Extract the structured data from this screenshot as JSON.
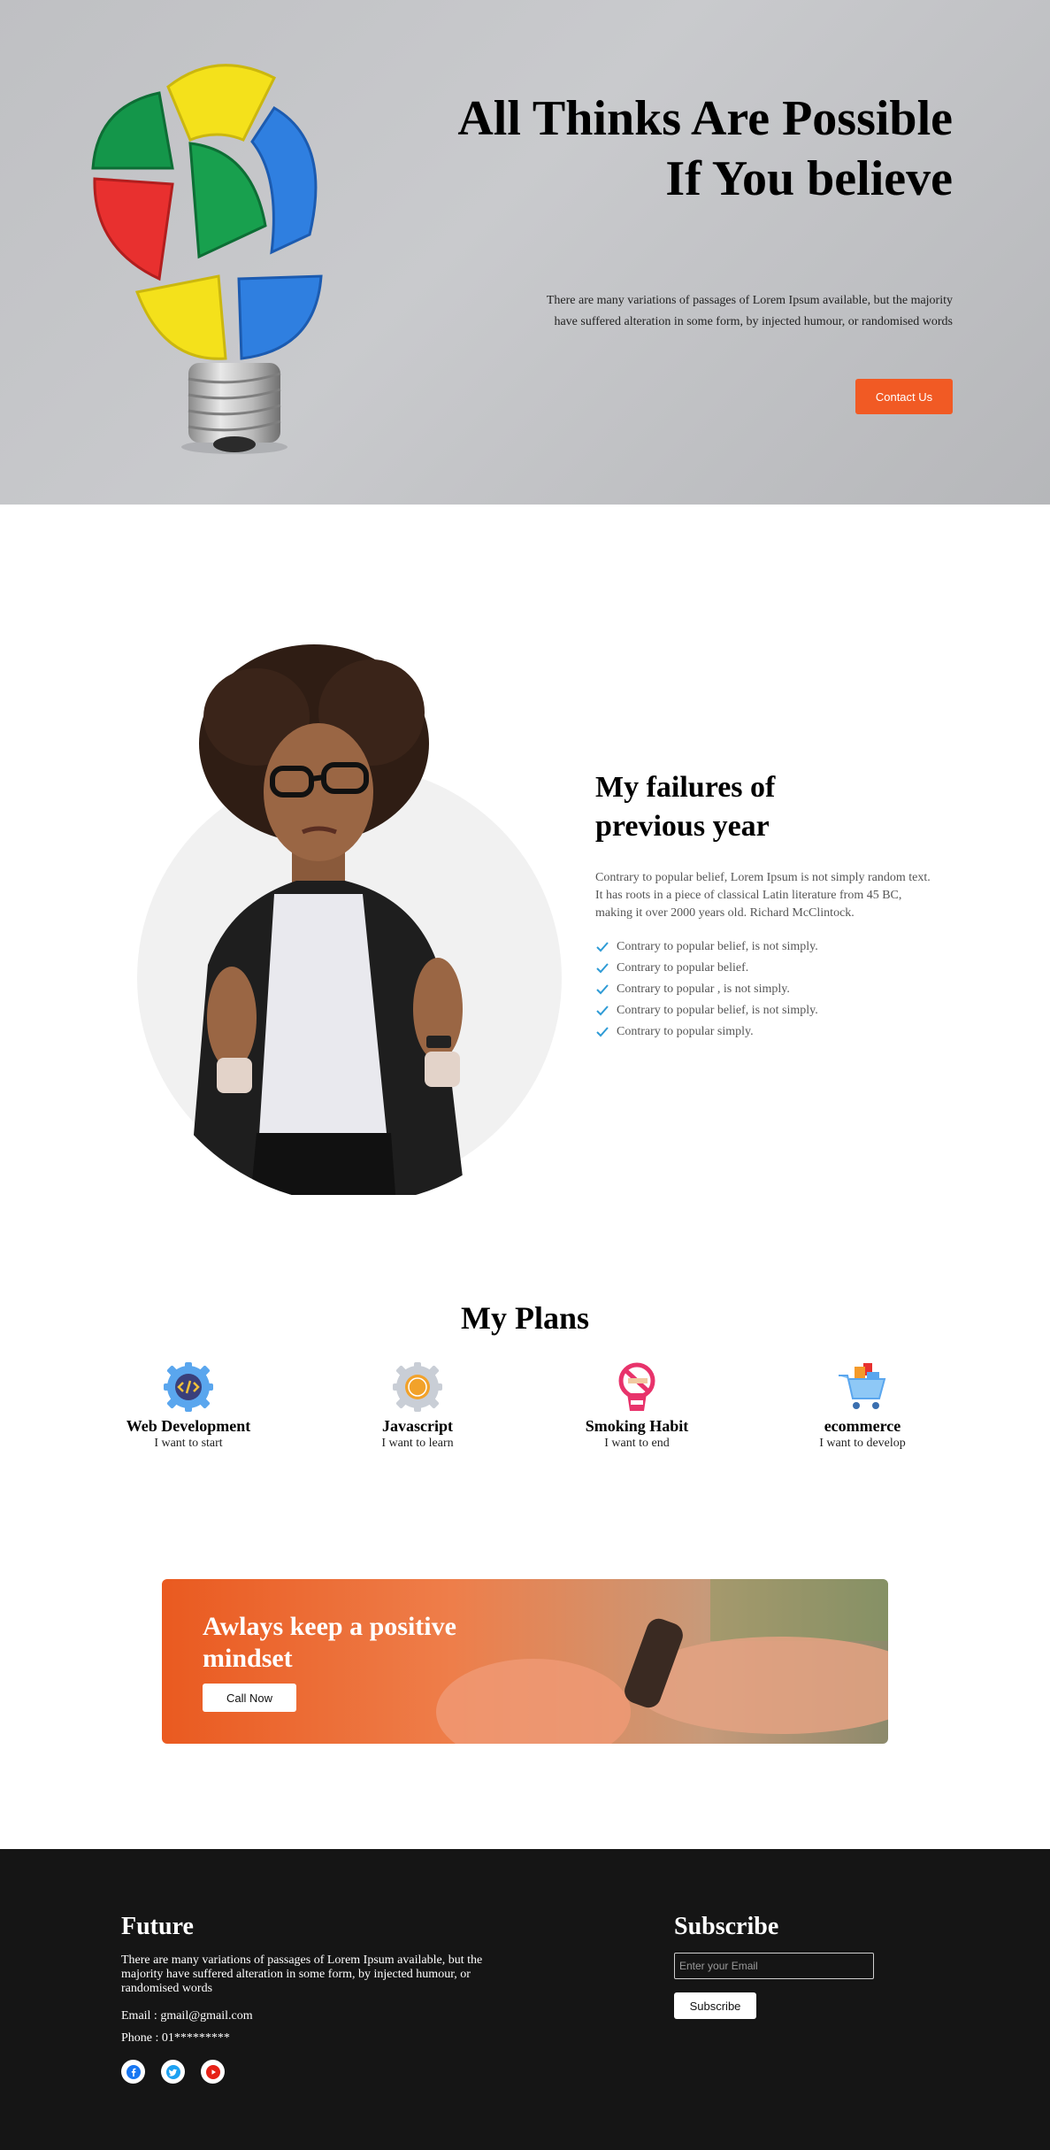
{
  "hero": {
    "title": "All Thinks Are Possible If You believe",
    "description": "There are many variations of passages of Lorem Ipsum available, but the majority have suffered alteration in some form, by injected humour, or randomised words",
    "button_label": "Contact Us",
    "colors": {
      "accent": "#f15a24",
      "background": "#c4c5c8"
    }
  },
  "about": {
    "title": "My failures of previous year",
    "description": "Contrary to popular belief, Lorem Ipsum is not simply random text. It has roots in a piece of classical Latin literature from 45 BC, making it over 2000 years old. Richard McClintock.",
    "checklist": [
      "Contrary to popular belief, is not simply.",
      "Contrary to popular belief.",
      "Contrary to popular , is not simply.",
      "Contrary to popular belief, is not simply.",
      "Contrary to popular simply."
    ],
    "check_color": "#2e9bd6"
  },
  "plans": {
    "title": "My Plans",
    "items": [
      {
        "name": "Web Development",
        "subtitle": "I want to start",
        "icon": "code-gear-icon"
      },
      {
        "name": "Javascript",
        "subtitle": "I want to learn",
        "icon": "js-gear-icon"
      },
      {
        "name": "Smoking Habit",
        "subtitle": "I want to end",
        "icon": "no-smoking-icon"
      },
      {
        "name": "ecommerce",
        "subtitle": "I want to develop",
        "icon": "shopping-cart-icon"
      }
    ]
  },
  "banner": {
    "title": "Awlays keep a positive mindset",
    "button_label": "Call Now"
  },
  "footer": {
    "brand": "Future",
    "description": "There are many variations of passages of Lorem Ipsum available, but the majority have suffered alteration in some form, by injected humour, or randomised words",
    "email": "Email : gmail@gmail.com",
    "phone": "Phone : 01*********",
    "socials": [
      "facebook-icon",
      "twitter-icon",
      "youtube-icon"
    ],
    "subscribe_title": "Subscribe",
    "email_placeholder": "Enter your Email",
    "subscribe_button": "Subscribe",
    "colors": {
      "background": "#151515"
    }
  }
}
